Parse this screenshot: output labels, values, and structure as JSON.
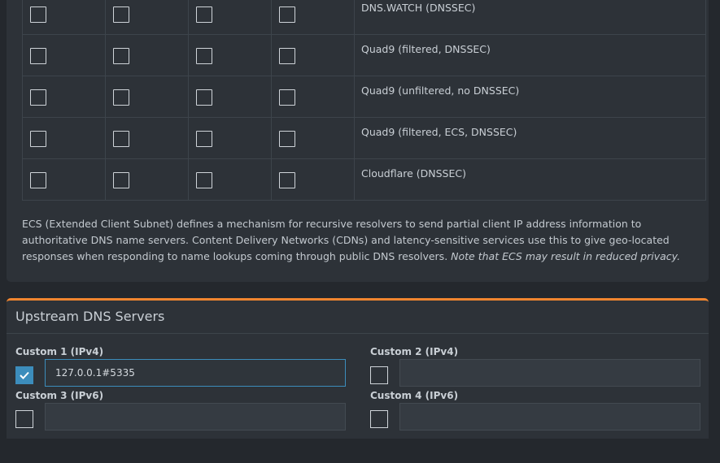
{
  "resolvers": [
    {
      "name": "DNS.WATCH (DNSSEC)"
    },
    {
      "name": "Quad9 (filtered, DNSSEC)"
    },
    {
      "name": "Quad9 (unfiltered, no DNSSEC)"
    },
    {
      "name": "Quad9 (filtered, ECS, DNSSEC)"
    },
    {
      "name": "Cloudflare (DNSSEC)"
    }
  ],
  "ecs_note": {
    "text": "ECS (Extended Client Subnet) defines a mechanism for recursive resolvers to send partial client IP address information to authoritative DNS name servers. Content Delivery Networks (CDNs) and latency-sensitive services use this to give geo-located responses when responding to name lookups coming through public DNS resolvers. ",
    "italic": "Note that ECS may result in reduced privacy."
  },
  "upstream": {
    "title": "Upstream DNS Servers",
    "custom1": {
      "label": "Custom 1 (IPv4)",
      "value": "127.0.0.1#5335",
      "checked": true
    },
    "custom2": {
      "label": "Custom 2 (IPv4)",
      "value": "",
      "checked": false
    },
    "custom3": {
      "label": "Custom 3 (IPv6)",
      "value": "",
      "checked": false
    },
    "custom4": {
      "label": "Custom 4 (IPv6)",
      "value": "",
      "checked": false
    }
  },
  "colors": {
    "accent": "#f0852f",
    "checked": "#3c8dbc"
  }
}
